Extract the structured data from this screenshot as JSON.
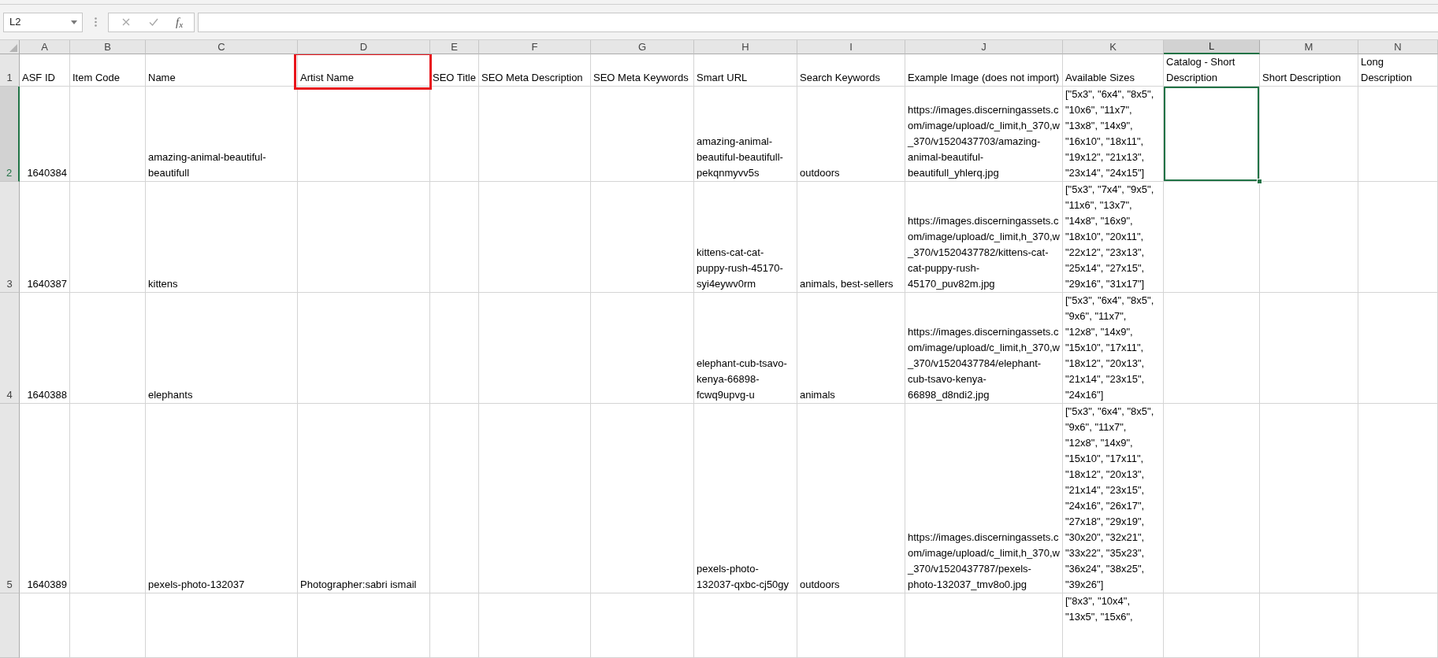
{
  "formula_bar": {
    "name_box": "L2",
    "function_button": "f$_{x}$"
  },
  "columns": [
    {
      "letter": "A",
      "kind": "number",
      "selected": false
    },
    {
      "letter": "B",
      "kind": "text",
      "selected": false
    },
    {
      "letter": "C",
      "kind": "text",
      "selected": false
    },
    {
      "letter": "D",
      "kind": "text",
      "selected": false
    },
    {
      "letter": "E",
      "kind": "text",
      "selected": false
    },
    {
      "letter": "F",
      "kind": "text",
      "selected": false
    },
    {
      "letter": "G",
      "kind": "text",
      "selected": false
    },
    {
      "letter": "H",
      "kind": "text",
      "selected": false
    },
    {
      "letter": "I",
      "kind": "text",
      "selected": false
    },
    {
      "letter": "J",
      "kind": "text",
      "selected": false
    },
    {
      "letter": "K",
      "kind": "text",
      "selected": false
    },
    {
      "letter": "L",
      "kind": "text",
      "selected": true
    },
    {
      "letter": "M",
      "kind": "text",
      "selected": false
    },
    {
      "letter": "N",
      "kind": "text",
      "selected": false
    }
  ],
  "header_row": {
    "number": "1",
    "selected": false,
    "cells": [
      {
        "text": "ASF ID",
        "outlined": false
      },
      {
        "text": "Item Code",
        "outlined": false
      },
      {
        "text": "Name",
        "outlined": false
      },
      {
        "text": "Artist Name",
        "outlined": true
      },
      {
        "text": "SEO Title",
        "outlined": false
      },
      {
        "text": "SEO Meta Description",
        "outlined": false
      },
      {
        "text": "SEO Meta Keywords",
        "outlined": false
      },
      {
        "text": "Smart URL",
        "outlined": false
      },
      {
        "text": "Search Keywords",
        "outlined": false
      },
      {
        "text": "Example Image (does not import)",
        "outlined": false
      },
      {
        "text": "Available Sizes",
        "outlined": false
      },
      {
        "text": "Catalog - Short Description",
        "outlined": false
      },
      {
        "text": "Short Description",
        "outlined": false
      },
      {
        "text": "Long Description",
        "outlined": false
      }
    ]
  },
  "rows": [
    {
      "number": "2",
      "selected": true,
      "clipped": false,
      "cells": [
        "1640384",
        null,
        "amazing-animal-beautiful-beautifull",
        null,
        null,
        null,
        null,
        "amazing-animal-beautiful-beautifull-pekqnmyvv5s",
        "outdoors",
        "https://images.discerningassets.com/image/upload/c_limit,h_370,w_370/v1520437703/amazing-animal-beautiful-beautifull_yhlerq.jpg",
        "[\"5x3\", \"6x4\", \"8x5\", \"10x6\", \"11x7\", \"13x8\", \"14x9\", \"16x10\", \"18x11\", \"19x12\", \"21x13\", \"23x14\", \"24x15\"]",
        null,
        null,
        null
      ]
    },
    {
      "number": "3",
      "selected": false,
      "clipped": false,
      "cells": [
        "1640387",
        null,
        "kittens",
        null,
        null,
        null,
        null,
        "kittens-cat-cat-puppy-rush-45170-syi4eywv0rm",
        "animals, best-sellers",
        "https://images.discerningassets.com/image/upload/c_limit,h_370,w_370/v1520437782/kittens-cat-cat-puppy-rush-45170_puv82m.jpg",
        "[\"5x3\", \"7x4\", \"9x5\", \"11x6\", \"13x7\", \"14x8\", \"16x9\", \"18x10\", \"20x11\", \"22x12\", \"23x13\", \"25x14\", \"27x15\", \"29x16\", \"31x17\"]",
        null,
        null,
        null
      ]
    },
    {
      "number": "4",
      "selected": false,
      "clipped": false,
      "cells": [
        "1640388",
        null,
        "elephants",
        null,
        null,
        null,
        null,
        "elephant-cub-tsavo-kenya-66898-fcwq9upvg-u",
        "animals",
        "https://images.discerningassets.com/image/upload/c_limit,h_370,w_370/v1520437784/elephant-cub-tsavo-kenya-66898_d8ndi2.jpg",
        "[\"5x3\", \"6x4\", \"8x5\", \"9x6\", \"11x7\", \"12x8\", \"14x9\", \"15x10\", \"17x11\", \"18x12\", \"20x13\", \"21x14\", \"23x15\", \"24x16\"]",
        null,
        null,
        null
      ]
    },
    {
      "number": "5",
      "selected": false,
      "clipped": false,
      "cells": [
        "1640389",
        null,
        "pexels-photo-132037",
        "Photographer:sabri ismail",
        null,
        null,
        null,
        "pexels-photo-132037-qxbc-cj50gy",
        "outdoors",
        "https://images.discerningassets.com/image/upload/c_limit,h_370,w_370/v1520437787/pexels-photo-132037_tmv8o0.jpg",
        "[\"5x3\", \"6x4\", \"8x5\", \"9x6\", \"11x7\", \"12x8\", \"14x9\", \"15x10\", \"17x11\", \"18x12\", \"20x13\", \"21x14\", \"23x15\", \"24x16\", \"26x17\", \"27x18\", \"29x19\", \"30x20\", \"32x21\", \"33x22\", \"35x23\", \"36x24\", \"38x25\", \"39x26\"]",
        null,
        null,
        null
      ]
    },
    {
      "selected": false,
      "clipped": true,
      "cells": [
        null,
        null,
        null,
        null,
        null,
        null,
        null,
        null,
        null,
        null,
        "[\"8x3\", \"10x4\", \"13x5\", \"15x6\",",
        null,
        null,
        null
      ]
    }
  ]
}
